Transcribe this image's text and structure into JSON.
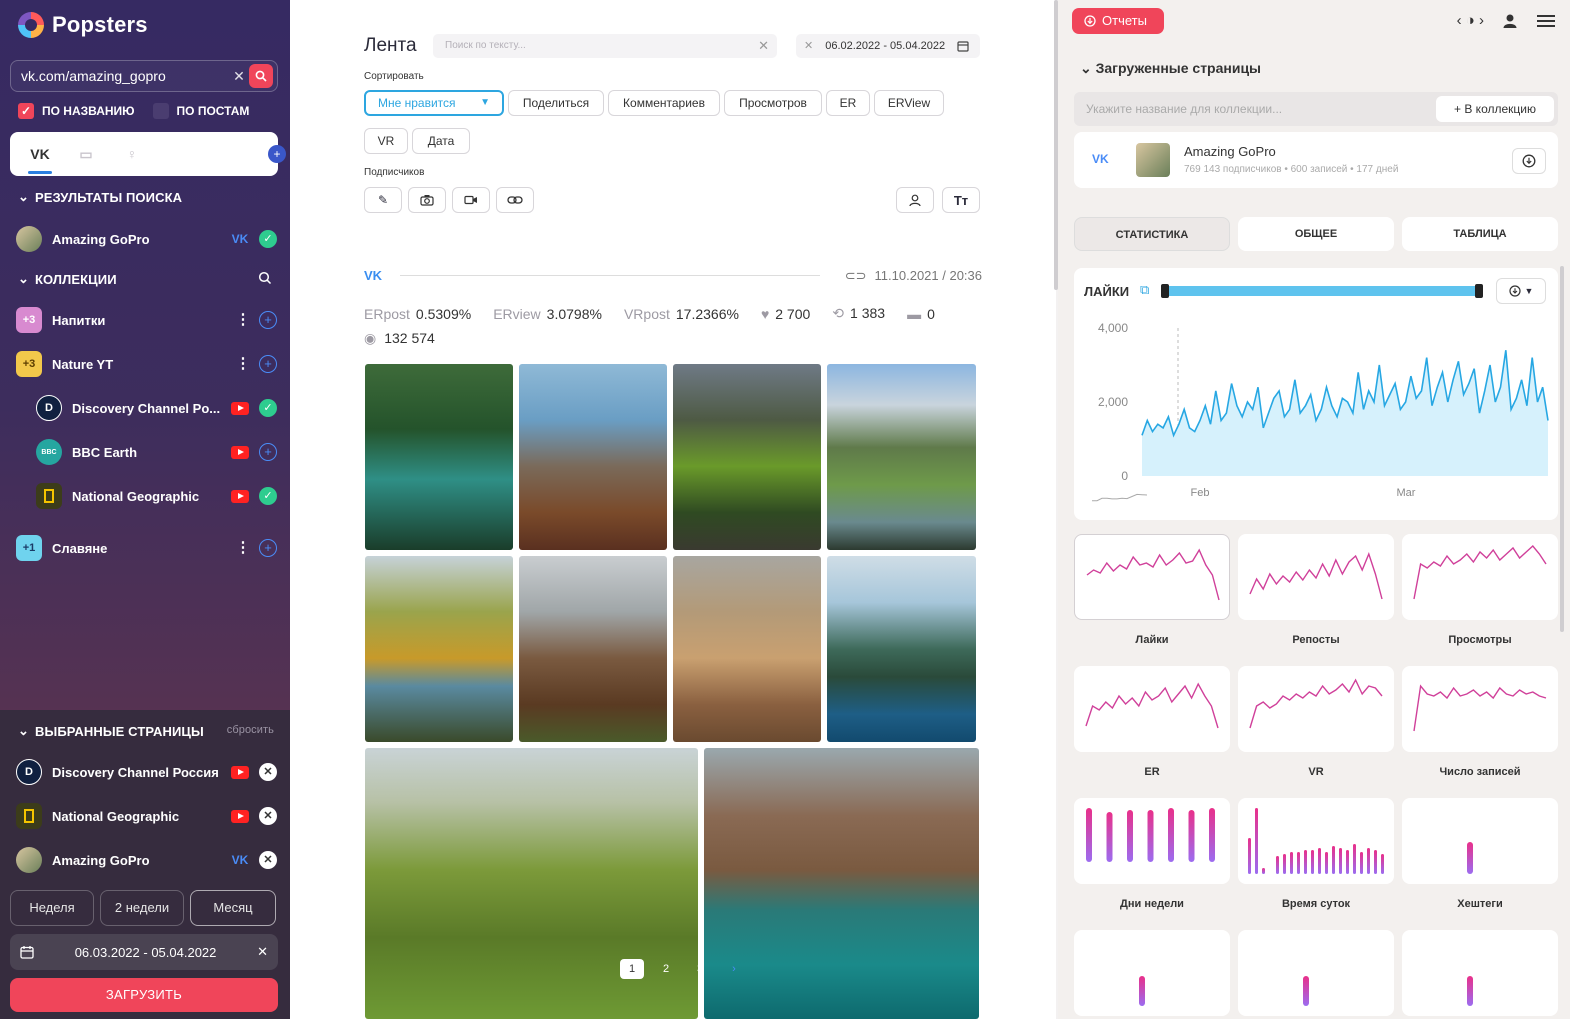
{
  "app": {
    "name": "Popsters"
  },
  "sidebar": {
    "search": {
      "value": "vk.com/amazing_gopro"
    },
    "checks": [
      {
        "label": "ПО НАЗВАНИЮ",
        "checked": true
      },
      {
        "label": "ПО ПОСТАМ",
        "checked": false
      }
    ],
    "results_header": "РЕЗУЛЬТАТЫ ПОИСКА",
    "results": [
      {
        "name": "Amazing GoPro",
        "network": "vk"
      }
    ],
    "collections_header": "КОЛЛЕКЦИИ",
    "collections": [
      {
        "badge": "+3",
        "name": "Напитки"
      },
      {
        "badge": "+3",
        "name": "Nature YT",
        "items": [
          {
            "name": "Discovery Channel Po...",
            "network": "youtube",
            "state": "added"
          },
          {
            "name": "BBC Earth",
            "network": "youtube",
            "state": "add"
          },
          {
            "name": "National Geographic",
            "network": "youtube",
            "state": "added"
          }
        ]
      },
      {
        "badge": "+1",
        "name": "Славяне"
      }
    ],
    "selected_header": "ВЫБРАННЫЕ СТРАНИЦЫ",
    "reset_label": "сбросить",
    "selected": [
      {
        "name": "Discovery Channel Россия",
        "network": "youtube"
      },
      {
        "name": "National Geographic",
        "network": "youtube"
      },
      {
        "name": "Amazing GoPro",
        "network": "vk"
      }
    ],
    "periods": [
      "Неделя",
      "2 недели",
      "Месяц"
    ],
    "date_range": "06.03.2022 - 05.04.2022",
    "load_label": "ЗАГРУЗИТЬ"
  },
  "feed": {
    "title": "Лента",
    "text_search_placeholder": "Поиск по тексту...",
    "date_range": "06.02.2022 - 05.04.2022",
    "sort_label": "Сортировать",
    "sort_options": [
      "Мне нравится",
      "Поделиться",
      "Комментариев",
      "Просмотров",
      "ER",
      "ERView",
      "VR",
      "Дата"
    ],
    "subscribers_label": "Подписчиков",
    "post": {
      "network": "vk",
      "datetime": "11.10.2021 / 20:36",
      "erpost_label": "ERpost",
      "erpost": "0.5309%",
      "erview_label": "ERview",
      "erview": "3.0798%",
      "vrpost_label": "VRpost",
      "vrpost": "17.2366%",
      "likes": "2 700",
      "reposts": "1 383",
      "comments": "0",
      "views": "132 574"
    },
    "pages": [
      "1",
      "2",
      "3"
    ]
  },
  "right": {
    "reports_label": "Отчеты",
    "loaded_header": "Загруженные страницы",
    "collection_placeholder": "Укажите название для коллекции...",
    "collection_button": "+ В коллекцию",
    "page": {
      "name": "Amazing GoPro",
      "meta": "769 143 подписчиков • 600 записей • 177 дней"
    },
    "tabs": [
      "СТАТИСТИКА",
      "ОБЩЕЕ",
      "ТАБЛИЦА"
    ],
    "chart_title": "ЛАЙКИ",
    "minis": [
      "Лайки",
      "Репосты",
      "Просмотры",
      "ER",
      "VR",
      "Число записей",
      "Дни недели",
      "Время суток",
      "Хештеги"
    ]
  },
  "chart_data": {
    "type": "area",
    "title": "ЛАЙКИ",
    "x_ticks": [
      "Feb",
      "Mar"
    ],
    "y_ticks": [
      "0",
      "2,000",
      "4,000"
    ],
    "ylim": [
      0,
      4000
    ],
    "series": [
      {
        "values": [
          1100,
          1500,
          1200,
          1400,
          1300,
          1600,
          1100,
          1400,
          1800,
          1300,
          1200,
          1500,
          1900,
          1400,
          2300,
          1500,
          1700,
          2500,
          1900,
          1600,
          2000,
          1800,
          2400,
          1300,
          1700,
          2100,
          2300,
          1600,
          1800,
          2600,
          1700,
          1900,
          2200,
          1500,
          1800,
          2400,
          1900,
          1600,
          2100,
          2000,
          1700,
          2800,
          1800,
          2300,
          2000,
          3000,
          1900,
          2200,
          2500,
          1800,
          2000,
          2700,
          2100,
          2300,
          3200,
          1900,
          2400,
          2800,
          2000,
          2600,
          3100,
          2200,
          2500,
          2900,
          1700,
          2300,
          3000,
          2000,
          2400,
          3400,
          1800,
          2100,
          2600,
          1900,
          3200,
          2000,
          2400,
          1500
        ]
      }
    ],
    "grid": false
  }
}
